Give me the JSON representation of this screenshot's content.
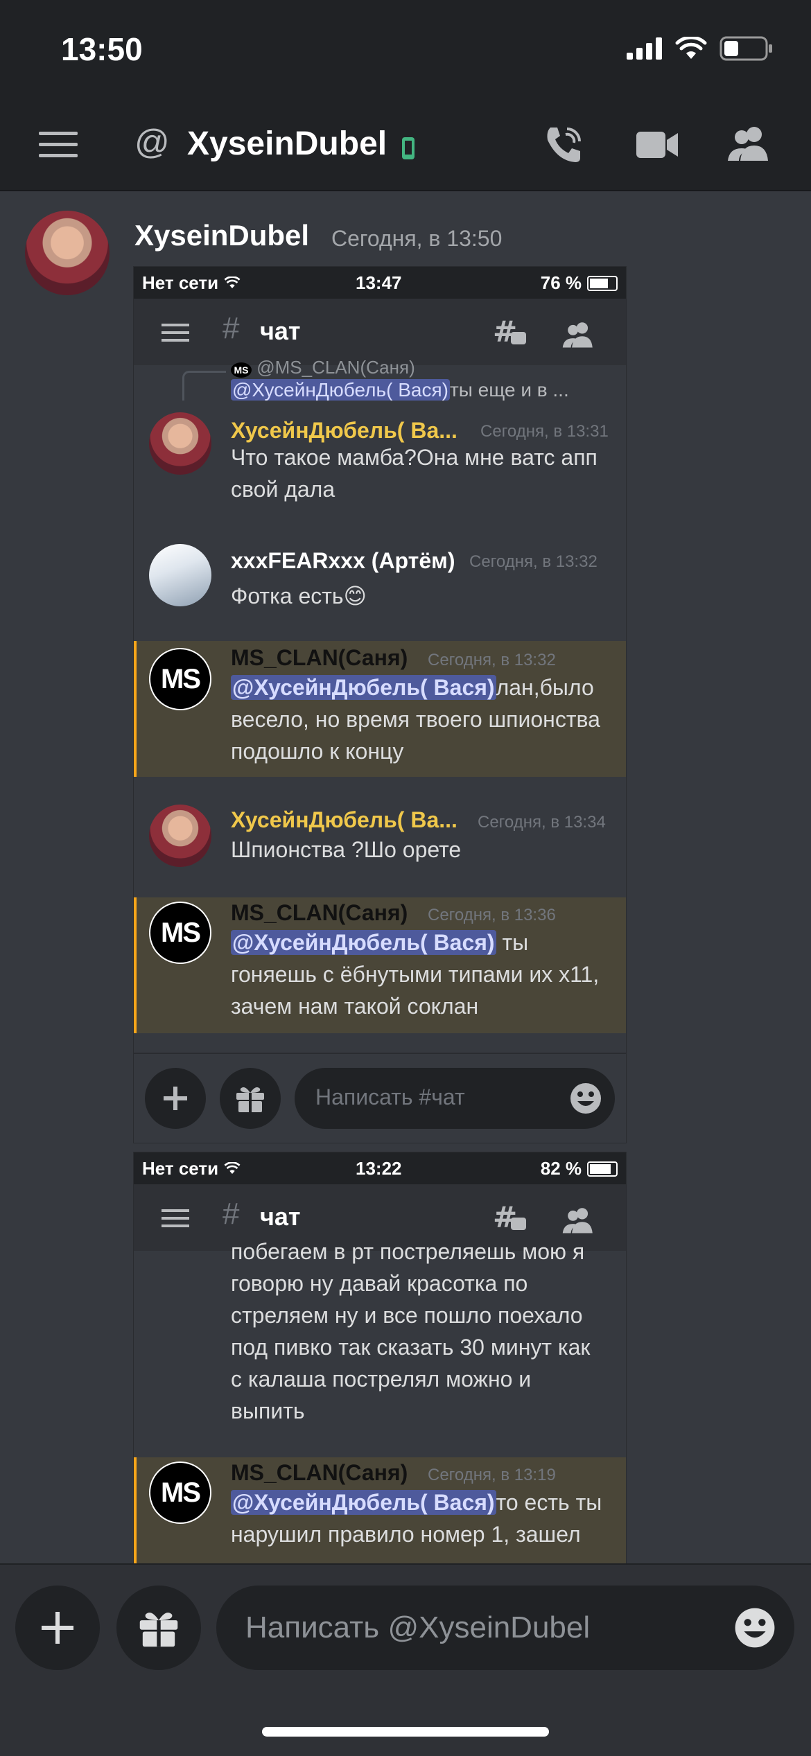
{
  "status_bar": {
    "time": "13:50"
  },
  "header": {
    "title": "XyseinDubel",
    "at_symbol": "@"
  },
  "message": {
    "author": "XyseinDubel",
    "timestamp": "Сегодня, в 13:50"
  },
  "screenshot1": {
    "status": {
      "carrier": "Нет сети",
      "time": "13:47",
      "battery": "76 %"
    },
    "channel": {
      "hash": "#",
      "name": "чат"
    },
    "reply_preview": {
      "author": "@MS_CLAN(Саня)",
      "mention": "@ХусейнДюбель( Вася)",
      "text": "ты еще и в ..."
    },
    "messages": [
      {
        "author": "ХусейнДюбель( Ва...",
        "time": "Сегодня, в 13:31",
        "text": "Что такое мамба?Она мне ватс апп свой дала"
      },
      {
        "author": "xxxFEARxxx (Артём)",
        "time": "Сегодня, в 13:32",
        "text": "Фотка есть😊"
      },
      {
        "author": "MS_CLAN(Саня)",
        "time": "Сегодня, в 13:32",
        "mention": "@ХусейнДюбель( Вася)",
        "text": "лан,было весело, но время твоего шпионства подошло к концу"
      },
      {
        "author": "ХусейнДюбель( Ва...",
        "time": "Сегодня, в 13:34",
        "text": "Шпионства ?Шо орете"
      },
      {
        "author": "MS_CLAN(Саня)",
        "time": "Сегодня, в 13:36",
        "mention": "@ХусейнДюбель( Вася)",
        "text": " ты гоняешь с ёбнутыми типами их x11, зачем нам такой соклан"
      }
    ],
    "input_placeholder": "Написать #чат"
  },
  "screenshot2": {
    "status": {
      "carrier": "Нет сети",
      "time": "13:22",
      "battery": "82 %"
    },
    "channel": {
      "hash": "#",
      "name": "чат"
    },
    "continued_text": "побегаем в рт постреляешь мою я говорю ну давай красотка по стреляем ну и все пошло поехало под пивко так сказать 30 минут как с калаша пострелял можно и выпить",
    "message": {
      "author": "MS_CLAN(Саня)",
      "time": "Сегодня, в 13:19",
      "mention": "@ХусейнДюбель( Вася)",
      "text": "то есть ты нарушил правило номер 1, зашел"
    }
  },
  "composer": {
    "placeholder": "Написать @XyseinDubel"
  },
  "avatar_text": "MS"
}
